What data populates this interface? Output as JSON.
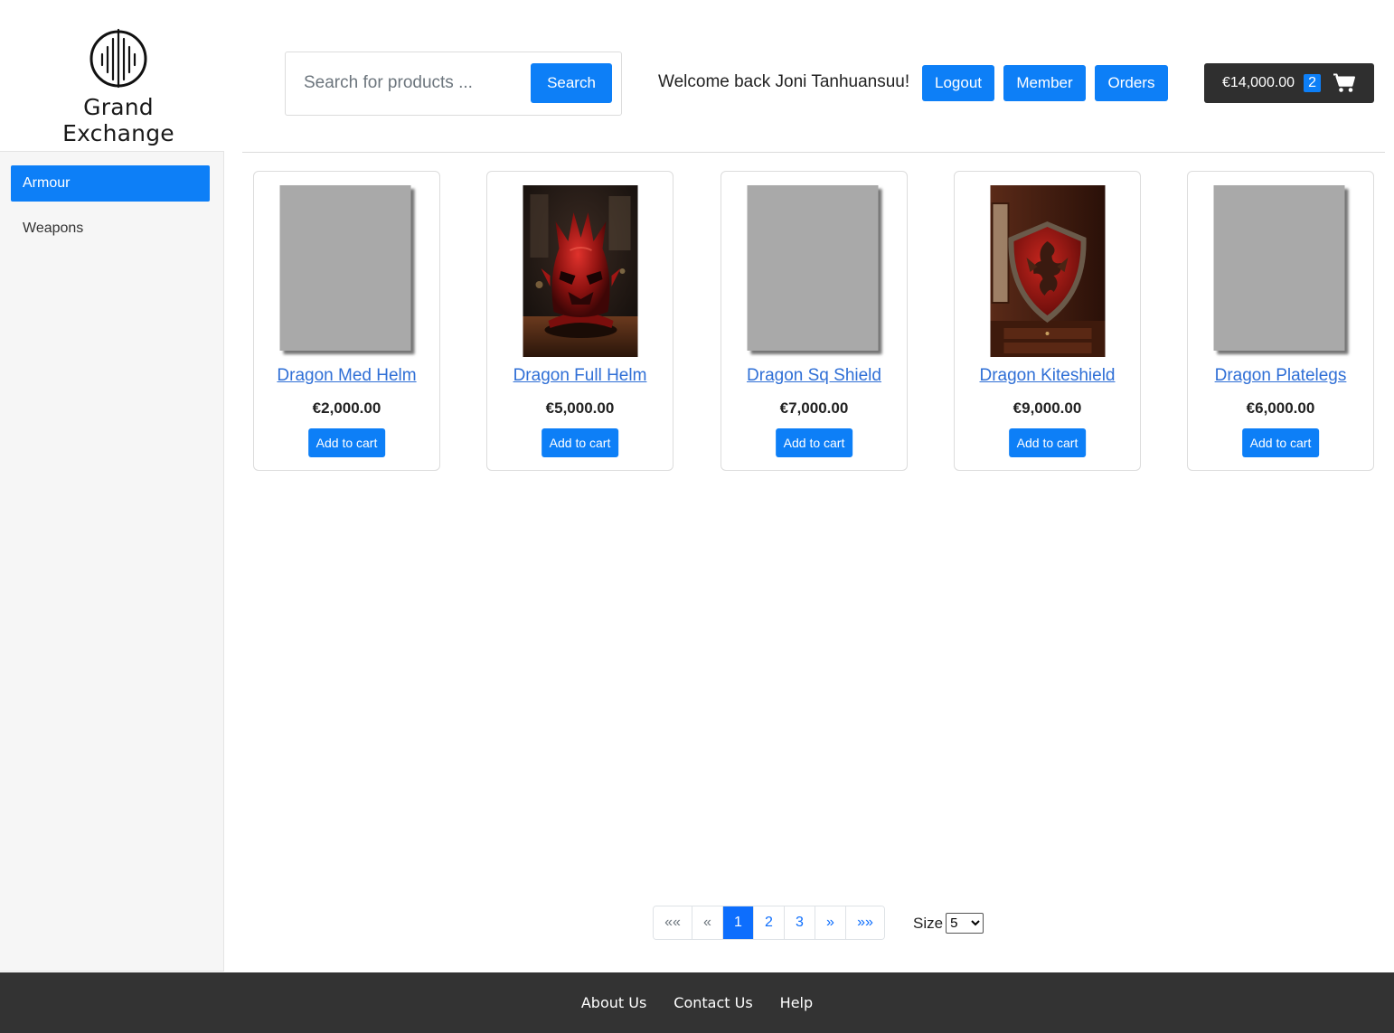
{
  "brand": {
    "name": "Grand Exchange",
    "logo_icon": "grand-exchange-logo"
  },
  "search": {
    "placeholder": "Search for products ...",
    "value": "",
    "button_label": "Search"
  },
  "user": {
    "welcome_text": "Welcome back Joni Tanhuansuu!"
  },
  "nav_buttons": {
    "logout": "Logout",
    "member": "Member",
    "orders": "Orders"
  },
  "cart": {
    "total": "€14,000.00",
    "count": "2",
    "icon": "shopping-cart-icon"
  },
  "sidebar": {
    "items": [
      {
        "label": "Armour",
        "active": true
      },
      {
        "label": "Weapons",
        "active": false
      }
    ]
  },
  "products": [
    {
      "name": "Dragon Med Helm",
      "price": "€2,000.00",
      "button": "Add to cart",
      "image": "placeholder"
    },
    {
      "name": "Dragon Full Helm",
      "price": "€5,000.00",
      "button": "Add to cart",
      "image": "red-dragon-helm"
    },
    {
      "name": "Dragon Sq Shield",
      "price": "€7,000.00",
      "button": "Add to cart",
      "image": "placeholder"
    },
    {
      "name": "Dragon Kiteshield",
      "price": "€9,000.00",
      "button": "Add to cart",
      "image": "red-dragon-shield"
    },
    {
      "name": "Dragon Platelegs",
      "price": "€6,000.00",
      "button": "Add to cart",
      "image": "placeholder"
    }
  ],
  "pagination": {
    "first": "««",
    "prev": "«",
    "pages": [
      "1",
      "2",
      "3"
    ],
    "current": "1",
    "next": "»",
    "last": "»»",
    "size_label": "Size",
    "size_value": "5"
  },
  "footer": {
    "links": [
      "About Us",
      "Contact Us",
      "Help"
    ]
  },
  "colors": {
    "primary": "#0d7ff7",
    "dark": "#333333",
    "sidebar_bg": "#f6f6f6",
    "link": "#2f6fd6",
    "placeholder_img": "#a9a9a9"
  }
}
